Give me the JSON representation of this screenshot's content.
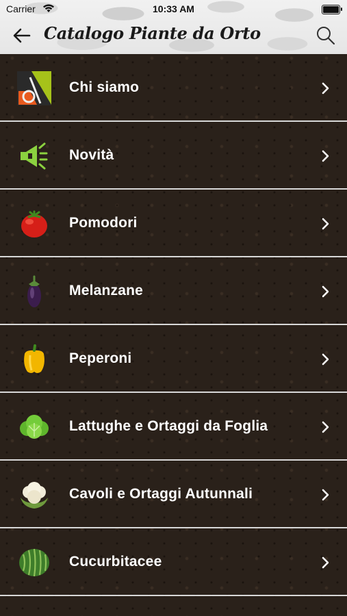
{
  "status_bar": {
    "carrier": "Carrier",
    "time": "10:33 AM"
  },
  "header": {
    "title": "Catalogo Piante da Orto"
  },
  "menu": {
    "items": [
      {
        "label": "Chi siamo",
        "icon": "company-logo-icon"
      },
      {
        "label": "Novità",
        "icon": "megaphone-icon"
      },
      {
        "label": "Pomodori",
        "icon": "tomato-icon"
      },
      {
        "label": "Melanzane",
        "icon": "eggplant-icon"
      },
      {
        "label": "Peperoni",
        "icon": "pepper-icon"
      },
      {
        "label": "Lattughe e Ortaggi da Foglia",
        "icon": "lettuce-icon"
      },
      {
        "label": "Cavoli e Ortaggi Autunnali",
        "icon": "cauliflower-icon"
      },
      {
        "label": "Cucurbitacee",
        "icon": "watermelon-icon"
      }
    ]
  },
  "colors": {
    "accent_green": "#8bd13f",
    "logo_orange": "#e85a1e",
    "logo_green": "#a6c21a"
  }
}
